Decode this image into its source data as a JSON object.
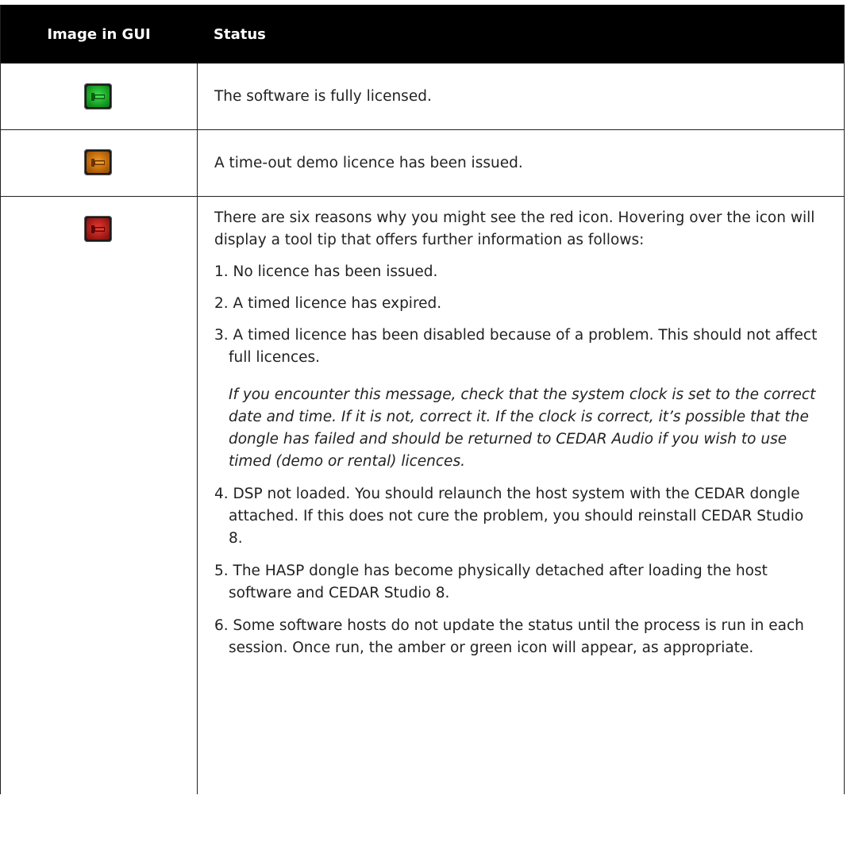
{
  "table": {
    "headers": {
      "image": "Image in GUI",
      "status": "Status"
    },
    "rows": [
      {
        "icon": "green-licence-icon",
        "color": "#1fb830",
        "text": "The software is fully licensed."
      },
      {
        "icon": "amber-licence-icon",
        "color": "#e07f10",
        "text": "A time-out demo licence has been issued."
      },
      {
        "icon": "red-licence-icon",
        "color": "#d0241f",
        "intro": "There are six reasons why you might see the red icon. Hovering over the icon will display a tool tip that offers further information as follows:",
        "items": [
          "1. No licence has been issued.",
          "2. A timed licence has expired.",
          "3. A timed licence has been disabled because of a problem. This should not affect full licences.",
          "4. DSP not loaded. You should relaunch the host system with the CEDAR dongle attached. If this does not cure the problem, you should reinstall CEDAR Studio 8.",
          "5. The HASP dongle has become physically detached after loading the host software and CEDAR Studio 8.",
          "6. Some software hosts do not update the status until the process is run in each session. Once run, the amber or green icon will appear, as appropriate."
        ],
        "note": "If you encounter this message, check that the system clock is set to the correct date and time. If it is not, correct it. If the clock is correct, it’s possible that the dongle has failed and should be returned to CEDAR Audio if you wish to use timed (demo or rental) licences."
      }
    ]
  }
}
